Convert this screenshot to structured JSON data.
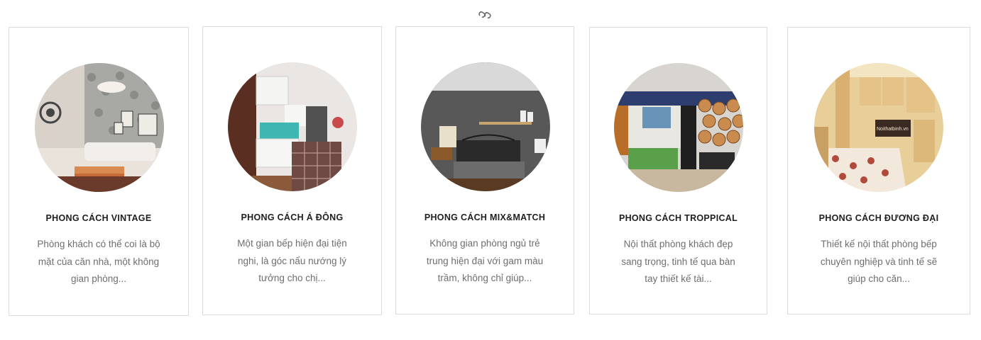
{
  "section": {
    "divider_icon": "chain-link-icon"
  },
  "cards": [
    {
      "title": "PHONG CÁCH VINTAGE",
      "description": "Phòng khách có thể coi là bộ mặt của căn nhà, một không gian phòng...",
      "image": "vintage-living-room"
    },
    {
      "title": "PHONG CÁCH Á ĐÔNG",
      "description": "Một gian bếp hiện đại tiện nghi, là góc nấu nướng lý tưởng cho chị...",
      "image": "asian-style-kitchen"
    },
    {
      "title": "PHONG CÁCH MIX&MATCH",
      "description": "Không gian phòng ngủ trẻ trung hiện đại với gam màu trầm, không chỉ giúp...",
      "image": "mix-match-bedroom"
    },
    {
      "title": "PHONG CÁCH TROPPICAL",
      "description": "Nội thất phòng khách đẹp sang trọng, tinh tế qua bàn tay thiết kế tài...",
      "image": "tropical-living-room"
    },
    {
      "title": "PHONG CÁCH ĐƯƠNG ĐẠI",
      "description": "Thiết kế nội thất phòng bếp chuyên nghiệp và tinh tế sẽ giúp cho căn...",
      "image": "contemporary-kitchen",
      "watermark": "Noithatbinh.vn"
    }
  ]
}
